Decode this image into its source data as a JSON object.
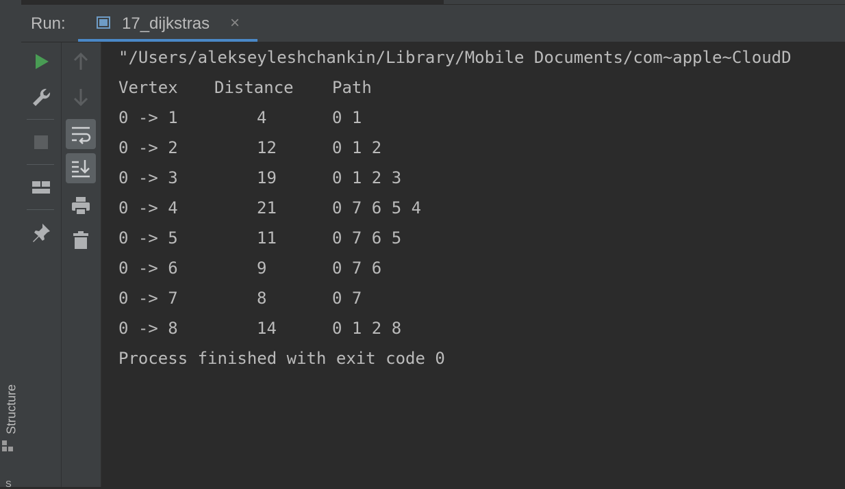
{
  "sidebar": {
    "structure_label": "Structure",
    "stray_glyph": "S"
  },
  "run_panel": {
    "label": "Run:",
    "tab": {
      "title": "17_dijkstras",
      "close": "×"
    }
  },
  "toolbar_left": {
    "items": [
      "run-icon",
      "wrench-icon",
      "stop-icon",
      "layout-icon",
      "pin-icon"
    ]
  },
  "toolbar_right": {
    "items": [
      "arrow-up-icon",
      "arrow-down-icon",
      "soft-wrap-icon",
      "scroll-to-end-icon",
      "print-icon",
      "trash-icon"
    ]
  },
  "console": {
    "command": "\"/Users/alekseyleshchankin/Library/Mobile Documents/com~apple~CloudD",
    "header": {
      "vertex": "Vertex",
      "distance": "Distance",
      "path": "Path"
    },
    "rows": [
      {
        "vertex": "0 -> 1",
        "distance": "4",
        "path": "0 1"
      },
      {
        "vertex": "0 -> 2",
        "distance": "12",
        "path": "0 1 2"
      },
      {
        "vertex": "0 -> 3",
        "distance": "19",
        "path": "0 1 2 3"
      },
      {
        "vertex": "0 -> 4",
        "distance": "21",
        "path": "0 7 6 5 4"
      },
      {
        "vertex": "0 -> 5",
        "distance": "11",
        "path": "0 7 6 5"
      },
      {
        "vertex": "0 -> 6",
        "distance": "9",
        "path": "0 7 6"
      },
      {
        "vertex": "0 -> 7",
        "distance": "8",
        "path": "0 7"
      },
      {
        "vertex": "0 -> 8",
        "distance": "14",
        "path": "0 1 2 8"
      }
    ],
    "exit_message": "Process finished with exit code 0"
  },
  "colors": {
    "background": "#2b2b2b",
    "panel": "#3c3f41",
    "text": "#bbbbbb",
    "run_green": "#499c54",
    "tab_underline": "#4a88c7"
  }
}
